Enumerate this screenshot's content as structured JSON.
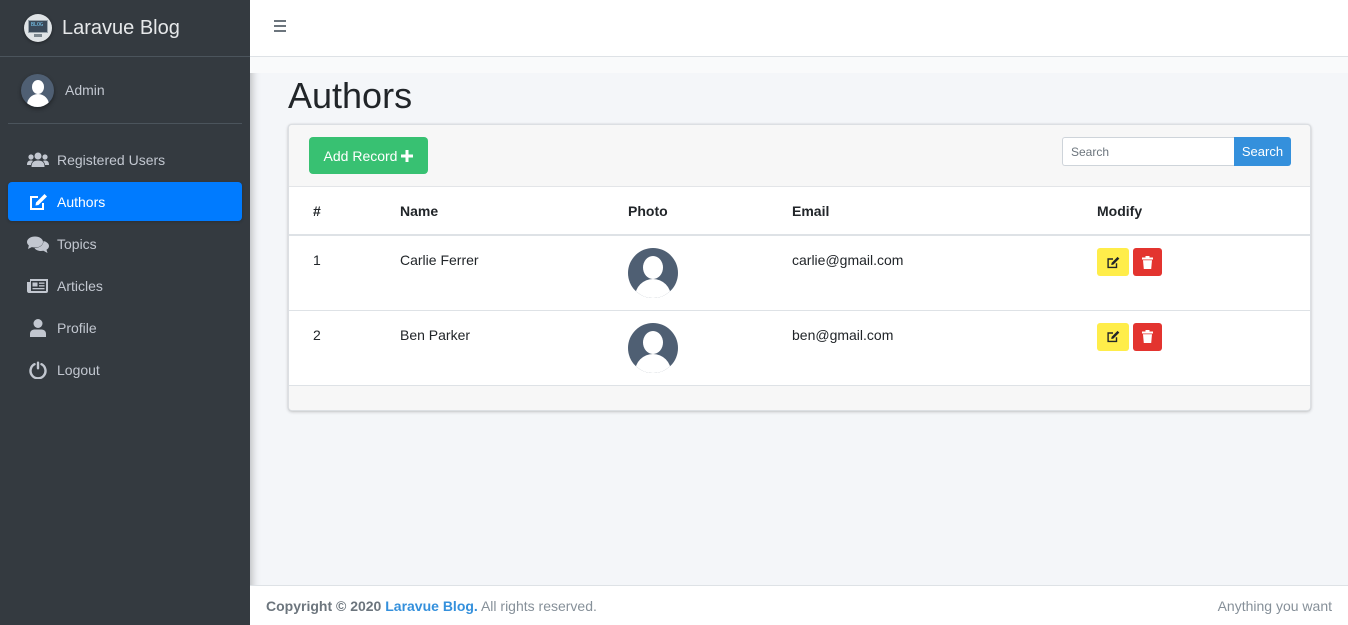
{
  "brand": {
    "name": "Laravue Blog",
    "logo_text": "BLOG"
  },
  "user": {
    "name": "Admin"
  },
  "sidebar": {
    "items": [
      {
        "label": "Registered Users",
        "icon": "users-icon",
        "active": false
      },
      {
        "label": "Authors",
        "icon": "edit-icon",
        "active": true
      },
      {
        "label": "Topics",
        "icon": "comments-icon",
        "active": false
      },
      {
        "label": "Articles",
        "icon": "newspaper-icon",
        "active": false
      },
      {
        "label": "Profile",
        "icon": "user-icon",
        "active": false
      },
      {
        "label": "Logout",
        "icon": "power-icon",
        "active": false
      }
    ]
  },
  "page": {
    "title": "Authors"
  },
  "toolbar": {
    "add_label": "Add Record",
    "search_placeholder": "Search",
    "search_button": "Search"
  },
  "table": {
    "headers": [
      "#",
      "Name",
      "Photo",
      "Email",
      "Modify"
    ],
    "rows": [
      {
        "id": "1",
        "name": "Carlie Ferrer",
        "email": "carlie@gmail.com"
      },
      {
        "id": "2",
        "name": "Ben Parker",
        "email": "ben@gmail.com"
      }
    ]
  },
  "footer": {
    "copyright_prefix": "Copyright © 2020",
    "brand_link": "Laravue Blog.",
    "rights": "All rights reserved.",
    "right_text": "Anything you want"
  },
  "colors": {
    "sidebar_bg": "#343a40",
    "active": "#007bff",
    "add_button": "#38c172",
    "search_button": "#3490dc",
    "edit_button": "#ffed4a",
    "delete_button": "#e3342f"
  }
}
